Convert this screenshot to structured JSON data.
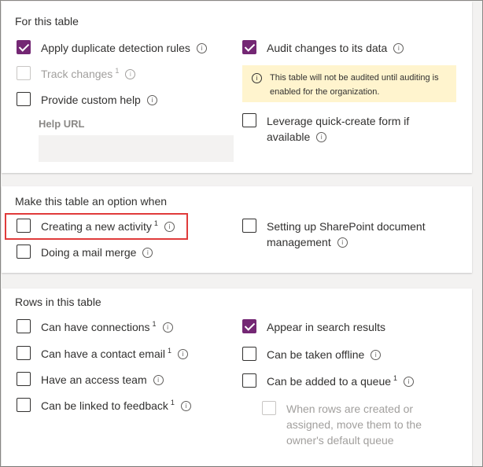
{
  "colors": {
    "accent": "#742774",
    "notice_bg": "#fff4ce",
    "highlight_border": "#e03b3b"
  },
  "section_table": {
    "heading": "For this table",
    "left": {
      "duplicate": {
        "label": "Apply duplicate detection rules",
        "checked": true
      },
      "track": {
        "label": "Track changes",
        "sup": "1",
        "checked": false,
        "disabled": true
      },
      "custom_help": {
        "label": "Provide custom help",
        "checked": false
      },
      "help_url": {
        "label": "Help URL",
        "value": ""
      }
    },
    "right": {
      "audit": {
        "label": "Audit changes to its data",
        "checked": true
      },
      "notice": "This table will not be audited until auditing is enabled for the organization.",
      "quick_create": {
        "label": "Leverage quick-create form if available",
        "checked": false
      }
    }
  },
  "section_option": {
    "heading": "Make this table an option when",
    "new_activity": {
      "label": "Creating a new activity",
      "sup": "1",
      "checked": false
    },
    "mail_merge": {
      "label": "Doing a mail merge",
      "checked": false
    },
    "sharepoint": {
      "label": "Setting up SharePoint document management",
      "checked": false
    }
  },
  "section_rows": {
    "heading": "Rows in this table",
    "connections": {
      "label": "Can have connections",
      "sup": "1",
      "checked": false
    },
    "contact_email": {
      "label": "Can have a contact email",
      "sup": "1",
      "checked": false
    },
    "access_team": {
      "label": "Have an access team",
      "checked": false
    },
    "feedback": {
      "label": "Can be linked to feedback",
      "sup": "1",
      "checked": false
    },
    "search": {
      "label": "Appear in search results",
      "checked": true
    },
    "offline": {
      "label": "Can be taken offline",
      "checked": false
    },
    "queue": {
      "label": "Can be added to a queue",
      "sup": "1",
      "checked": false
    },
    "move_queue": {
      "label": "When rows are created or assigned, move them to the owner's default queue",
      "checked": false,
      "disabled": true
    }
  }
}
